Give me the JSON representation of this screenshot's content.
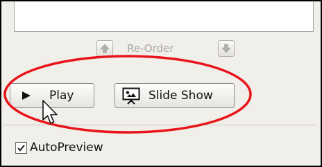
{
  "reorder": {
    "label": "Re-Order",
    "up_icon": "arrow-up-icon",
    "down_icon": "arrow-down-icon"
  },
  "buttons": {
    "play_label": "Play",
    "play_icon": "play-triangle-icon",
    "slideshow_label": "Slide Show",
    "slideshow_icon": "presentation-screen-icon"
  },
  "autopreview": {
    "label": "AutoPreview",
    "checked": true
  },
  "colors": {
    "panel_bg": "#f1efe9",
    "highlight_ellipse": "#e8141b",
    "disabled_text": "#a9a7a2"
  }
}
